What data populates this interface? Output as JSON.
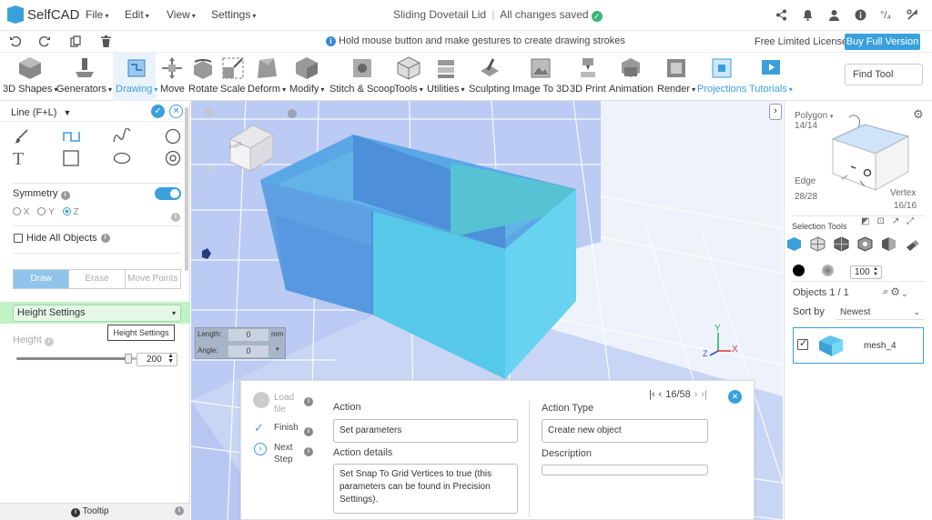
{
  "app": {
    "name": "SelfCAD",
    "doc_title": "Sliding Dovetail Lid",
    "save_status": "All changes saved"
  },
  "menus": [
    {
      "label": "File"
    },
    {
      "label": "Edit"
    },
    {
      "label": "View"
    },
    {
      "label": "Settings"
    }
  ],
  "top_icons": [
    {
      "icon": "share-icon"
    },
    {
      "icon": "bell-icon"
    },
    {
      "icon": "user-icon"
    },
    {
      "icon": "info-icon"
    },
    {
      "icon": "units-icon",
      "label": "°/₄"
    },
    {
      "icon": "settings-icon"
    }
  ],
  "row2": {
    "hint": "Hold mouse button and make gestures to create drawing strokes",
    "license": "Free Limited License",
    "buy": "Buy Full Version"
  },
  "tools": [
    {
      "label": "3D Shapes",
      "dropdown": true
    },
    {
      "label": "Generators",
      "dropdown": true
    },
    {
      "label": "Drawing",
      "dropdown": true,
      "active": true
    },
    {
      "label": "Move"
    },
    {
      "label": "Rotate"
    },
    {
      "label": "Scale"
    },
    {
      "label": "Deform",
      "dropdown": true
    },
    {
      "label": "Modify",
      "dropdown": true
    },
    {
      "label": "Stitch & Scoop"
    },
    {
      "label": "Tools",
      "dropdown": true
    },
    {
      "label": "Utilities",
      "dropdown": true
    },
    {
      "label": "Sculpting"
    },
    {
      "label": "Image To 3D"
    },
    {
      "label": "3D Print"
    },
    {
      "label": "Animation"
    },
    {
      "label": "Render",
      "dropdown": true
    },
    {
      "label": "Projections",
      "active": true
    },
    {
      "label": "Tutorials",
      "dropdown": true,
      "active": true
    }
  ],
  "find_tool": "Find Tool",
  "left_panel": {
    "title": "Line (F+L)",
    "symmetry_label": "Symmetry",
    "symmetry_on": true,
    "axes": [
      "X",
      "Y",
      "Z"
    ],
    "axis_selected": "Z",
    "hide_all": "Hide All Objects",
    "draw_tabs": [
      "Draw",
      "Erase",
      "Move Points"
    ],
    "height_settings": "Height Settings",
    "tooltip": "Height Settings",
    "height_label": "Height",
    "height_value": "200",
    "height_fraction": 0.93,
    "bottom_label": "Tooltip"
  },
  "viewport": {
    "length_label": "Length:",
    "length_value": "0",
    "length_unit": "mm",
    "angle_label": "Angle:",
    "angle_value": "0",
    "axis_y": "Y",
    "axis_x": "X",
    "axis_z": "Z",
    "cube_face": "Front",
    "colors": {
      "box_left": "#5fa4e3",
      "box_right": "#52c9e8",
      "box_inner": "#5dbad0"
    }
  },
  "right_panel": {
    "polygon_label": "Polygon",
    "polygon_count": "14/14",
    "edge_label": "Edge",
    "edge_count": "28/28",
    "vertex_label": "Vertex",
    "vertex_count": "16/16",
    "selection_tools": "Selection Tools",
    "brush_value": "100",
    "objects_label": "Objects 1 / 1",
    "sort_by": "Sort by",
    "sort_value": "Newest",
    "object_name": "mesh_4"
  },
  "action_panel": {
    "steps": [
      {
        "label": "Load file"
      },
      {
        "label": "Finish"
      },
      {
        "label": "Next Step"
      }
    ],
    "pager": "16/58",
    "action_label": "Action",
    "action_value": "Set parameters",
    "action_type_label": "Action Type",
    "action_type_value": "Create new object",
    "details_label": "Action details",
    "details_value": "Set Snap To Grid Vertices to true (this parameters can be found in Precision Settings).",
    "description_label": "Description",
    "description_value": ""
  }
}
